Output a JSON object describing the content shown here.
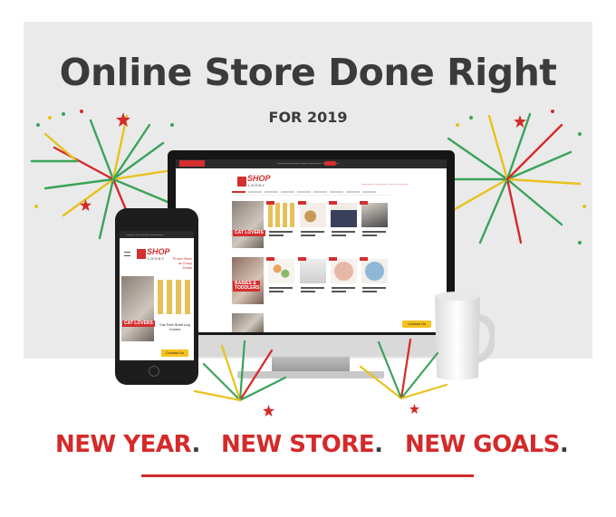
{
  "headline": "Online Store Done Right",
  "subhead": "FOR 2019",
  "slogans": {
    "one": "NEW YEAR",
    "two": "NEW STORE",
    "three": "NEW GOALS",
    "separator": "."
  },
  "website": {
    "brand_top": "SHOP",
    "brand_bottom": "LOONY",
    "desktop_categories": [
      "CAT LOVERS",
      "BABIES & TODDLERS"
    ],
    "mobile_category": "CAT LOVERS",
    "mobile_tagline": "Proud Store at Crazy Deals",
    "mobile_product": "Cat Feet Shelf Leg Covers",
    "contact_button": "Contact Us"
  },
  "colors": {
    "accent_red": "#d42a2a",
    "headline_gray": "#3b3b3b",
    "panel_gray": "#eaeaea",
    "firework_green": "#3aa35a",
    "firework_yellow": "#e8c21c",
    "contact_yellow": "#f6c21c"
  },
  "icons": [
    "firework-burst-icon",
    "star-icon",
    "coffee-mug-icon",
    "shopping-bag-logo-icon",
    "hamburger-menu-icon"
  ]
}
